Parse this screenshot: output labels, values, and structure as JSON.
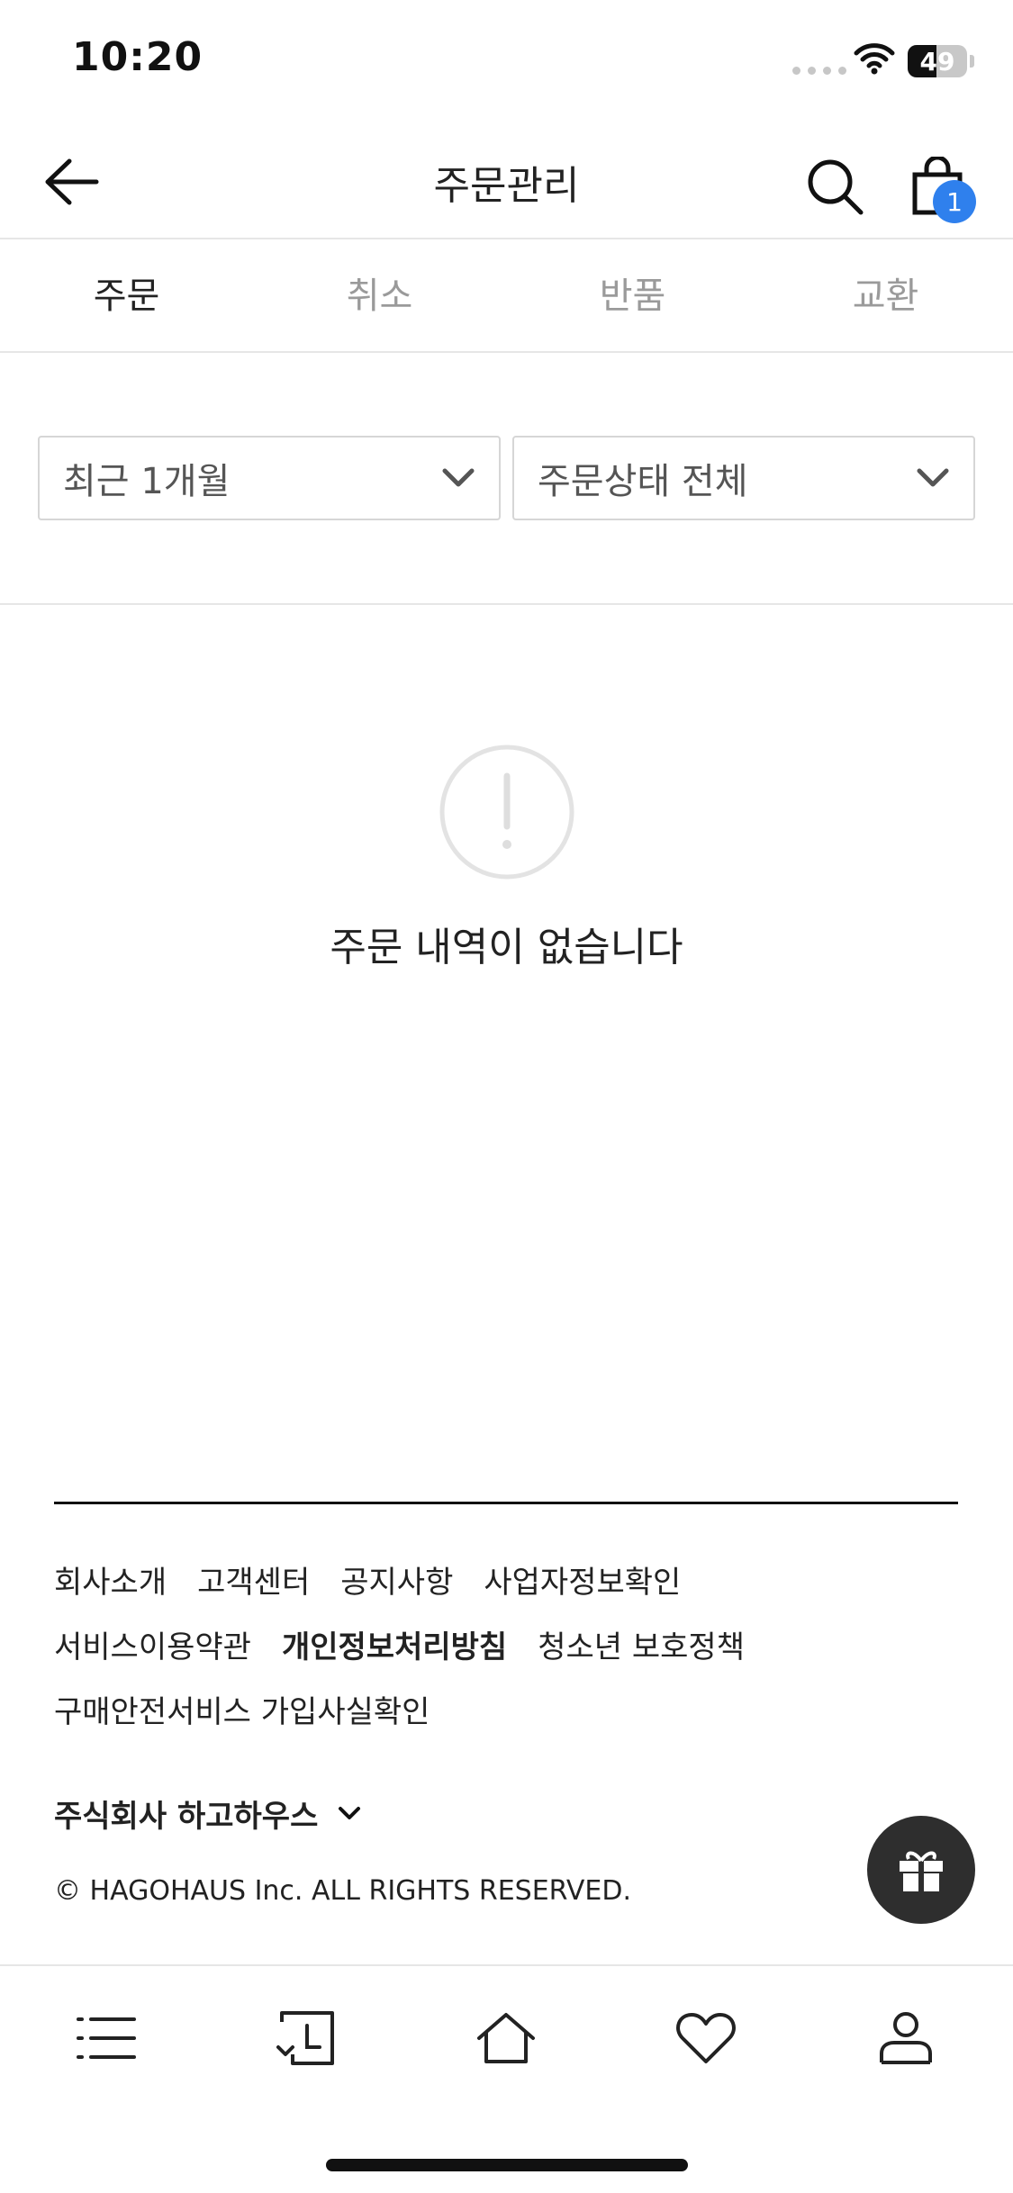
{
  "status_bar": {
    "time": "10:20",
    "battery_level": "49",
    "battery_fraction": 0.49
  },
  "header": {
    "title": "주문관리",
    "cart_count": "1"
  },
  "tabs": [
    {
      "label": "주문",
      "active": true
    },
    {
      "label": "취소",
      "active": false
    },
    {
      "label": "반품",
      "active": false
    },
    {
      "label": "교환",
      "active": false
    }
  ],
  "filters": {
    "period": "최근 1개월",
    "status": "주문상태 전체"
  },
  "empty_state": {
    "message": "주문 내역이 없습니다"
  },
  "footer": {
    "row1": [
      "회사소개",
      "고객센터",
      "공지사항",
      "사업자정보확인"
    ],
    "row2": [
      "서비스이용약관",
      "개인정보처리방침",
      "청소년 보호정책"
    ],
    "row3": [
      "구매안전서비스 가입사실확인"
    ],
    "company": "주식회사 하고하우스",
    "copyright": "© HAGOHAUS Inc. ALL RIGHTS RESERVED."
  },
  "colors": {
    "accent": "#2f80ed",
    "gift_button": "#2e2e2e"
  },
  "icons": {
    "header": [
      "back-arrow-icon",
      "search-icon",
      "shopping-bag-icon"
    ],
    "bottom_nav": [
      "menu-icon",
      "recent-history-icon",
      "home-icon",
      "heart-icon",
      "user-icon"
    ],
    "floating": "gift-icon",
    "empty": "exclamation-circle-icon"
  }
}
